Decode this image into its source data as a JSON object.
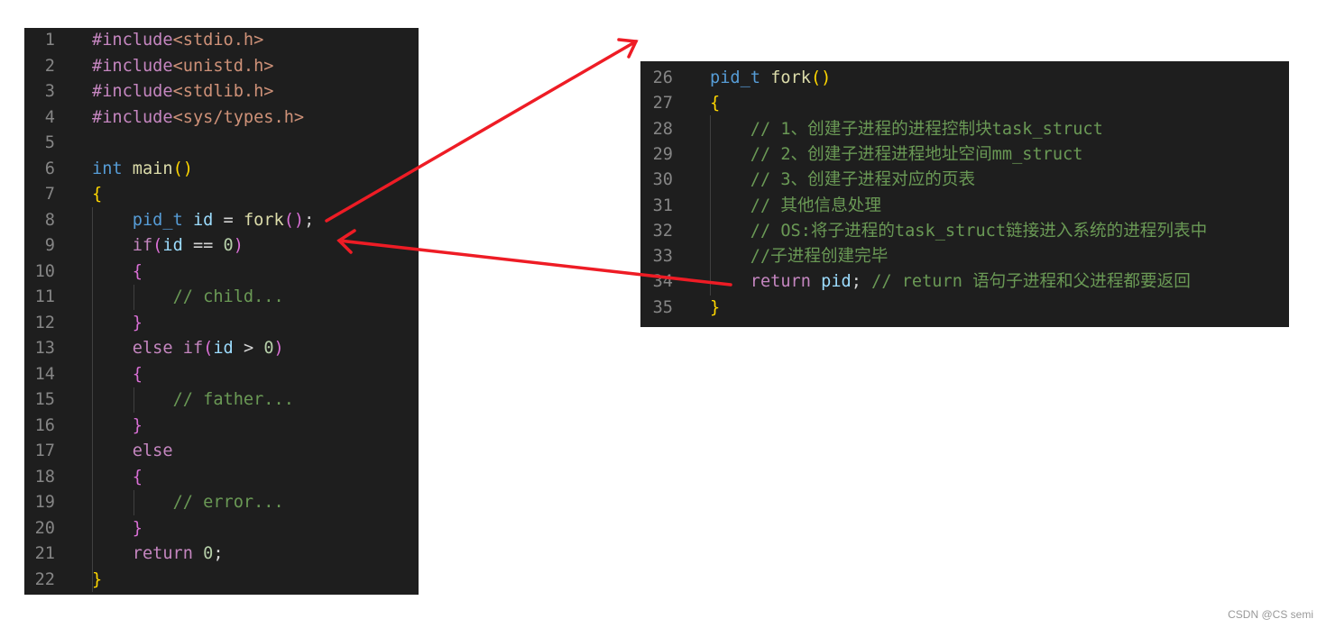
{
  "left_panel": {
    "lines": [
      {
        "n": "1",
        "t": [
          [
            "#include",
            "kw"
          ],
          [
            "<stdio.h>",
            "str"
          ]
        ]
      },
      {
        "n": "2",
        "t": [
          [
            "#include",
            "kw"
          ],
          [
            "<unistd.h>",
            "str"
          ]
        ]
      },
      {
        "n": "3",
        "t": [
          [
            "#include",
            "kw"
          ],
          [
            "<stdlib.h>",
            "str"
          ]
        ]
      },
      {
        "n": "4",
        "t": [
          [
            "#include",
            "kw"
          ],
          [
            "<sys/types.h>",
            "str"
          ]
        ]
      },
      {
        "n": "5",
        "t": []
      },
      {
        "n": "6",
        "t": [
          [
            "int",
            "ty"
          ],
          [
            " ",
            "pl"
          ],
          [
            "main",
            "fn"
          ],
          [
            "()",
            "br"
          ]
        ]
      },
      {
        "n": "7",
        "t": [
          [
            "{",
            "br"
          ]
        ]
      },
      {
        "n": "8",
        "t": [
          [
            "    ",
            "pl"
          ],
          [
            "pid_t",
            "ty"
          ],
          [
            " ",
            "pl"
          ],
          [
            "id",
            "var"
          ],
          [
            " = ",
            "pl"
          ],
          [
            "fork",
            "fn"
          ],
          [
            "()",
            "pa"
          ],
          [
            ";",
            "pl"
          ]
        ]
      },
      {
        "n": "9",
        "t": [
          [
            "    ",
            "pl"
          ],
          [
            "if",
            "kw"
          ],
          [
            "(",
            "pa"
          ],
          [
            "id",
            "var"
          ],
          [
            " == ",
            "pl"
          ],
          [
            "0",
            "num"
          ],
          [
            ")",
            "pa"
          ]
        ]
      },
      {
        "n": "10",
        "t": [
          [
            "    ",
            "pl"
          ],
          [
            "{",
            "pa"
          ]
        ]
      },
      {
        "n": "11",
        "t": [
          [
            "        ",
            "pl"
          ],
          [
            "// child...",
            "cm"
          ]
        ]
      },
      {
        "n": "12",
        "t": [
          [
            "    ",
            "pl"
          ],
          [
            "}",
            "pa"
          ]
        ]
      },
      {
        "n": "13",
        "t": [
          [
            "    ",
            "pl"
          ],
          [
            "else if",
            "kw"
          ],
          [
            "(",
            "pa"
          ],
          [
            "id",
            "var"
          ],
          [
            " > ",
            "pl"
          ],
          [
            "0",
            "num"
          ],
          [
            ")",
            "pa"
          ]
        ]
      },
      {
        "n": "14",
        "t": [
          [
            "    ",
            "pl"
          ],
          [
            "{",
            "pa"
          ]
        ]
      },
      {
        "n": "15",
        "t": [
          [
            "        ",
            "pl"
          ],
          [
            "// father...",
            "cm"
          ]
        ]
      },
      {
        "n": "16",
        "t": [
          [
            "    ",
            "pl"
          ],
          [
            "}",
            "pa"
          ]
        ]
      },
      {
        "n": "17",
        "t": [
          [
            "    ",
            "pl"
          ],
          [
            "else",
            "kw"
          ]
        ]
      },
      {
        "n": "18",
        "t": [
          [
            "    ",
            "pl"
          ],
          [
            "{",
            "pa"
          ]
        ]
      },
      {
        "n": "19",
        "t": [
          [
            "        ",
            "pl"
          ],
          [
            "// error...",
            "cm"
          ]
        ]
      },
      {
        "n": "20",
        "t": [
          [
            "    ",
            "pl"
          ],
          [
            "}",
            "pa"
          ]
        ]
      },
      {
        "n": "21",
        "t": [
          [
            "    ",
            "pl"
          ],
          [
            "return",
            "kw"
          ],
          [
            " ",
            "pl"
          ],
          [
            "0",
            "num"
          ],
          [
            ";",
            "pl"
          ]
        ]
      },
      {
        "n": "22",
        "t": [
          [
            "}",
            "br"
          ]
        ]
      }
    ]
  },
  "right_panel": {
    "lines": [
      {
        "n": "26",
        "t": [
          [
            "pid_t",
            "ty"
          ],
          [
            " ",
            "pl"
          ],
          [
            "fork",
            "fn"
          ],
          [
            "()",
            "br"
          ]
        ]
      },
      {
        "n": "27",
        "t": [
          [
            "{",
            "br"
          ]
        ]
      },
      {
        "n": "28",
        "t": [
          [
            "    ",
            "pl"
          ],
          [
            "// 1、创建子进程的进程控制块task_struct",
            "cm"
          ]
        ]
      },
      {
        "n": "29",
        "t": [
          [
            "    ",
            "pl"
          ],
          [
            "// 2、创建子进程进程地址空间mm_struct",
            "cm"
          ]
        ]
      },
      {
        "n": "30",
        "t": [
          [
            "    ",
            "pl"
          ],
          [
            "// 3、创建子进程对应的页表",
            "cm"
          ]
        ]
      },
      {
        "n": "31",
        "t": [
          [
            "    ",
            "pl"
          ],
          [
            "// 其他信息处理",
            "cm"
          ]
        ]
      },
      {
        "n": "32",
        "t": [
          [
            "    ",
            "pl"
          ],
          [
            "// OS:将子进程的task_struct链接进入系统的进程列表中",
            "cm"
          ]
        ]
      },
      {
        "n": "33",
        "t": [
          [
            "    ",
            "pl"
          ],
          [
            "//子进程创建完毕",
            "cm"
          ]
        ]
      },
      {
        "n": "34",
        "t": [
          [
            "    ",
            "pl"
          ],
          [
            "return",
            "kw"
          ],
          [
            " ",
            "pl"
          ],
          [
            "pid",
            "var"
          ],
          [
            "; ",
            "pl"
          ],
          [
            "// return 语句子进程和父进程都要返回",
            "cm"
          ]
        ]
      },
      {
        "n": "35",
        "t": [
          [
            "}",
            "br"
          ]
        ]
      }
    ]
  },
  "arrow_color": "#ee1c25",
  "watermark": "CSDN @CS semi"
}
